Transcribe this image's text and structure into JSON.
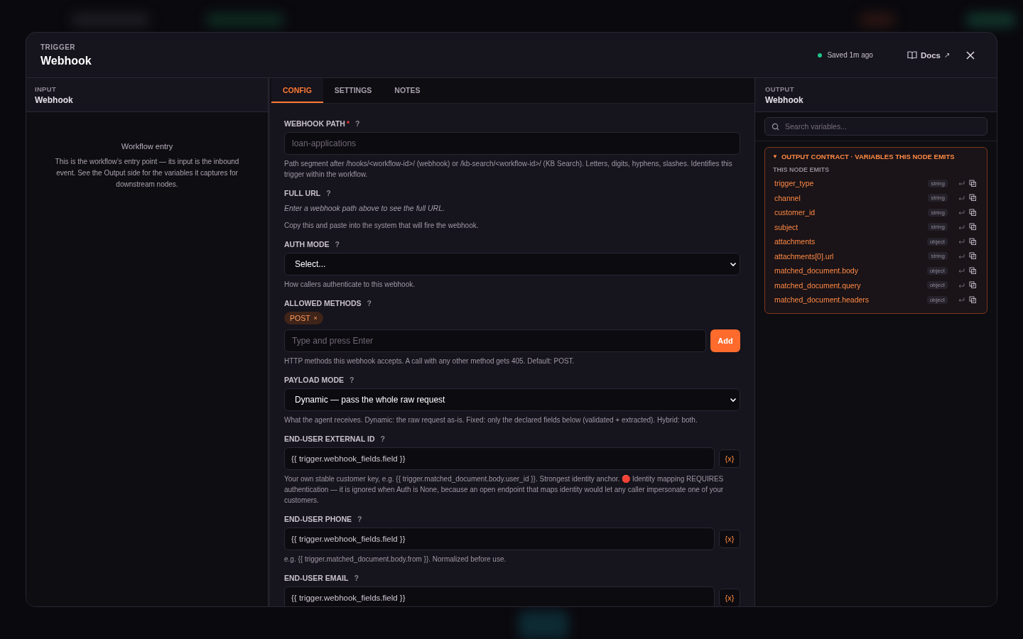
{
  "header": {
    "eyebrow": "TRIGGER",
    "title": "Webhook",
    "status": "Saved 1m ago",
    "docs": {
      "label": "Docs",
      "arrow": "↗"
    }
  },
  "input_panel": {
    "eyebrow": "INPUT",
    "title": "Webhook",
    "heading": "Workflow entry",
    "text": "This is the workflow’s entry point — its input is the inbound event. See the Output side for the variables it captures for downstream nodes."
  },
  "tabs": [
    {
      "label": "CONFIG",
      "selected": true
    },
    {
      "label": "SETTINGS",
      "selected": false
    },
    {
      "label": "NOTES",
      "selected": false
    }
  ],
  "fields": [
    {
      "kind": "text",
      "label": "WEBHOOK PATH",
      "required_mark": "*",
      "help": "?",
      "placeholder": "loan-applications",
      "hint": "Path segment after /hooks/<workflow-id>/ (webhook) or /kb-search/<workflow-id>/ (KB Search). Letters, digits, hyphens, slashes. Identifies this trigger within the workflow."
    },
    {
      "kind": "readonly",
      "label": "FULL URL",
      "help": "?",
      "value": "Enter a webhook path above to see the full URL.",
      "hint": "Copy this and paste into the system that will fire the webhook."
    },
    {
      "kind": "select",
      "label": "AUTH MODE",
      "help": "?",
      "value": "Select...",
      "hint": "How callers authenticate to this webhook."
    },
    {
      "kind": "tags",
      "label": "ALLOWED METHODS",
      "help": "?",
      "tags": [
        {
          "label": "POST",
          "remove": "×"
        }
      ],
      "placeholder": "Type and press Enter",
      "button": "Add",
      "hint": "HTTP methods this webhook accepts. A call with any other method gets 405. Default: POST."
    },
    {
      "kind": "select",
      "label": "PAYLOAD MODE",
      "help": "?",
      "value": "Dynamic — pass the whole raw request",
      "hint": "What the agent receives. Dynamic: the raw request as-is. Fixed: only the declared fields below (validated + extracted). Hybrid: both."
    },
    {
      "kind": "variable",
      "label": "END-USER EXTERNAL ID",
      "help": "?",
      "value": "{{ trigger.webhook_fields.field }}",
      "button": "{x}",
      "hint": "Your own stable customer key, e.g. {{ trigger.matched_document.body.user_id }}. Strongest identity anchor. 🛑 Identity mapping REQUIRES authentication — it is ignored when Auth is None, because an open endpoint that maps identity would let any caller impersonate one of your customers."
    },
    {
      "kind": "variable",
      "label": "END-USER PHONE",
      "help": "?",
      "value": "{{ trigger.webhook_fields.field }}",
      "button": "{x}",
      "hint": "e.g. {{ trigger.matched_document.body.from }}. Normalized before use."
    },
    {
      "kind": "variable",
      "label": "END-USER EMAIL",
      "help": "?",
      "value": "{{ trigger.webhook_fields.field }}",
      "button": "{x}"
    }
  ],
  "output_panel": {
    "eyebrow": "OUTPUT",
    "title": "Webhook",
    "search_placeholder": "Search variables...",
    "contract": {
      "caret": "▼",
      "title": "OUTPUT CONTRACT · VARIABLES THIS NODE EMITS",
      "expanded": true,
      "subtitle": "THIS NODE EMITS",
      "variables": [
        {
          "name": "trigger_type",
          "type": "string"
        },
        {
          "name": "channel",
          "type": "string"
        },
        {
          "name": "customer_id",
          "type": "string"
        },
        {
          "name": "subject",
          "type": "string"
        },
        {
          "name": "attachments",
          "type": "object"
        },
        {
          "name": "attachments[0].url",
          "type": "string"
        },
        {
          "name": "matched_document.body",
          "type": "object"
        },
        {
          "name": "matched_document.query",
          "type": "object"
        },
        {
          "name": "matched_document.headers",
          "type": "object"
        }
      ]
    }
  }
}
